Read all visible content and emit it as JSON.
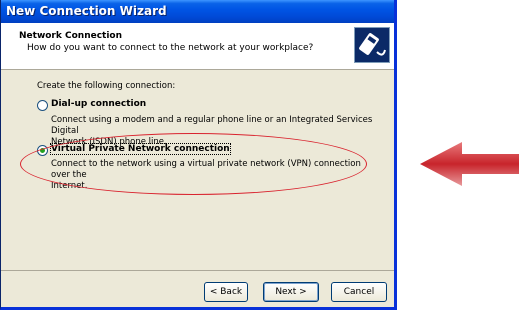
{
  "window": {
    "title": "New Connection Wizard"
  },
  "header": {
    "title": "Network Connection",
    "subtitle": "How do you want to connect to the network at your workplace?",
    "icon": "network-connection-icon"
  },
  "body": {
    "prompt": "Create the following connection:",
    "options": [
      {
        "label": "Dial-up connection",
        "description_line1": "Connect using a modem and a regular phone line or an Integrated Services Digital",
        "description_line2": "Network (ISDN) phone line.",
        "selected": false
      },
      {
        "label": "Virtual Private Network connection",
        "description_line1": "Connect to the network using a virtual private network (VPN) connection over the",
        "description_line2": "Internet.",
        "selected": true
      }
    ]
  },
  "buttons": {
    "back": "< Back",
    "next": "Next >",
    "cancel": "Cancel"
  },
  "colors": {
    "title_bar": "#0055e5",
    "annotation": "#d9232e",
    "radio_selected": "#21a121"
  }
}
